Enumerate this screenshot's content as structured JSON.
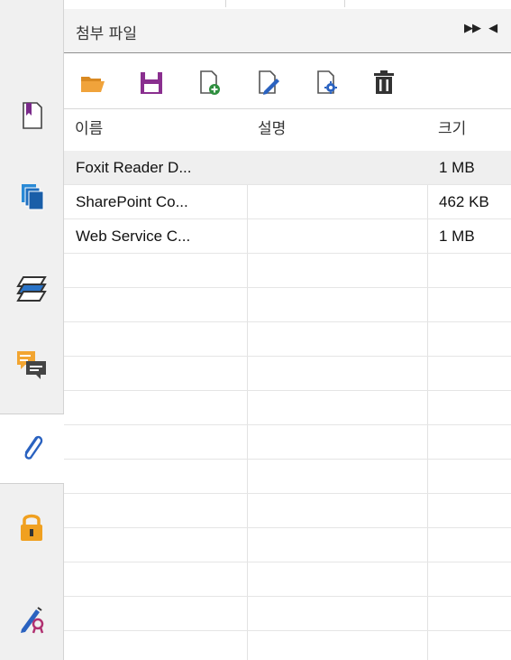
{
  "panel": {
    "title": "첨부 파일",
    "header_arrows": "⏩ ◀"
  },
  "toolbar": {
    "buttons": [
      {
        "name": "open-folder-icon",
        "color": "#f0a33b"
      },
      {
        "name": "save-icon",
        "color": "#8a2f8f"
      },
      {
        "name": "add-file-icon",
        "color": "#2f8f3f"
      },
      {
        "name": "edit-file-icon",
        "color": "#2a62c0"
      },
      {
        "name": "file-settings-icon",
        "color": "#2a62c0"
      },
      {
        "name": "delete-icon",
        "color": "#333333"
      }
    ]
  },
  "columns": [
    "이름",
    "설명",
    "크기"
  ],
  "files": [
    {
      "name": "Foxit Reader D...",
      "description": "",
      "size": "1 MB",
      "selected": true
    },
    {
      "name": "SharePoint Co...",
      "description": "",
      "size": "462 KB",
      "selected": false
    },
    {
      "name": "Web Service C...",
      "description": "",
      "size": "1 MB",
      "selected": false
    }
  ],
  "empty_rows": 11,
  "sidebar": {
    "items": [
      {
        "name": "pages-icon",
        "active": false
      },
      {
        "name": "thumbnails-icon",
        "active": false
      },
      {
        "name": "layers-icon",
        "active": false
      },
      {
        "name": "comments-icon",
        "active": false
      },
      {
        "name": "attachments-icon",
        "active": true
      },
      {
        "name": "security-lock-icon",
        "active": false
      },
      {
        "name": "signatures-icon",
        "active": false
      }
    ]
  },
  "colors": {
    "accent_blue": "#2a62c0",
    "orange": "#f0a33b",
    "purple": "#8a2f8f",
    "green": "#2f8f3f"
  }
}
